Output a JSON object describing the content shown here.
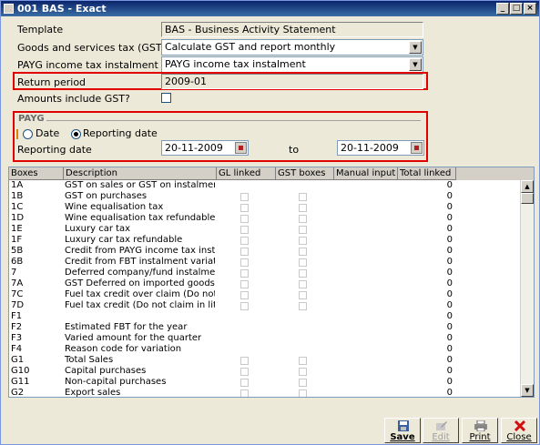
{
  "window": {
    "title": "001 BAS - Exact"
  },
  "form": {
    "template_label": "Template",
    "template_value": "BAS - Business Activity Statement",
    "gst_label": "Goods and services tax (GST)",
    "gst_value": "Calculate GST and report monthly",
    "payg_label": "PAYG income tax instalment",
    "payg_value": "PAYG income tax instalment",
    "return_period_label": "Return period",
    "return_period_value": "2009-01",
    "amounts_gst_label": "Amounts include GST?"
  },
  "payg_section": {
    "title": "PAYG",
    "radio_date": "Date",
    "radio_reporting": "Reporting date",
    "reporting_date_label": "Reporting date",
    "from_date": "20-11-2009",
    "to_label": "to",
    "to_date": "20-11-2009"
  },
  "grid": {
    "columns": [
      "Boxes",
      "Description",
      "GL linked",
      "GST boxes",
      "Manual input",
      "Total linked"
    ],
    "rows": [
      {
        "box": "1A",
        "desc": "GST on sales or GST on instalment",
        "total": "0",
        "chk": false
      },
      {
        "box": "1B",
        "desc": "GST on purchases",
        "total": "0",
        "chk": true
      },
      {
        "box": "1C",
        "desc": "Wine equalisation tax",
        "total": "0",
        "chk": true
      },
      {
        "box": "1D",
        "desc": "Wine equalisation tax refundable",
        "total": "0",
        "chk": true
      },
      {
        "box": "1E",
        "desc": "Luxury car tax",
        "total": "0",
        "chk": true
      },
      {
        "box": "1F",
        "desc": "Luxury car tax refundable",
        "total": "0",
        "chk": true
      },
      {
        "box": "5B",
        "desc": "Credit from PAYG income tax instaln",
        "total": "0",
        "chk": true
      },
      {
        "box": "6B",
        "desc": "Credit from FBT instalment variation",
        "total": "0",
        "chk": true
      },
      {
        "box": "7",
        "desc": "Deferred company/fund instalment",
        "total": "0",
        "chk": true
      },
      {
        "box": "7A",
        "desc": "GST Deferred on imported goods",
        "total": "0",
        "chk": true
      },
      {
        "box": "7C",
        "desc": "Fuel tax credit over claim (Do not cla",
        "total": "0",
        "chk": true
      },
      {
        "box": "7D",
        "desc": "Fuel tax credit (Do not claim in litres",
        "total": "0",
        "chk": true
      },
      {
        "box": "F1",
        "desc": "",
        "total": "0",
        "chk": false
      },
      {
        "box": "F2",
        "desc": "Estimated FBT for the year",
        "total": "0",
        "chk": false
      },
      {
        "box": "F3",
        "desc": "Varied amount for the quarter",
        "total": "0",
        "chk": false
      },
      {
        "box": "F4",
        "desc": "Reason code for variation",
        "total": "0",
        "chk": false
      },
      {
        "box": "G1",
        "desc": "Total Sales",
        "total": "0",
        "chk": true
      },
      {
        "box": "G10",
        "desc": "Capital purchases",
        "total": "0",
        "chk": true
      },
      {
        "box": "G11",
        "desc": "Non-capital purchases",
        "total": "0",
        "chk": true
      },
      {
        "box": "G2",
        "desc": "Export sales",
        "total": "0",
        "chk": true
      }
    ]
  },
  "buttons": {
    "save": "Save",
    "edit": "Edit",
    "print": "Print",
    "close": "Close"
  },
  "colors": {
    "highlight_box": "#e00000",
    "title_bar": "#0a246a"
  }
}
